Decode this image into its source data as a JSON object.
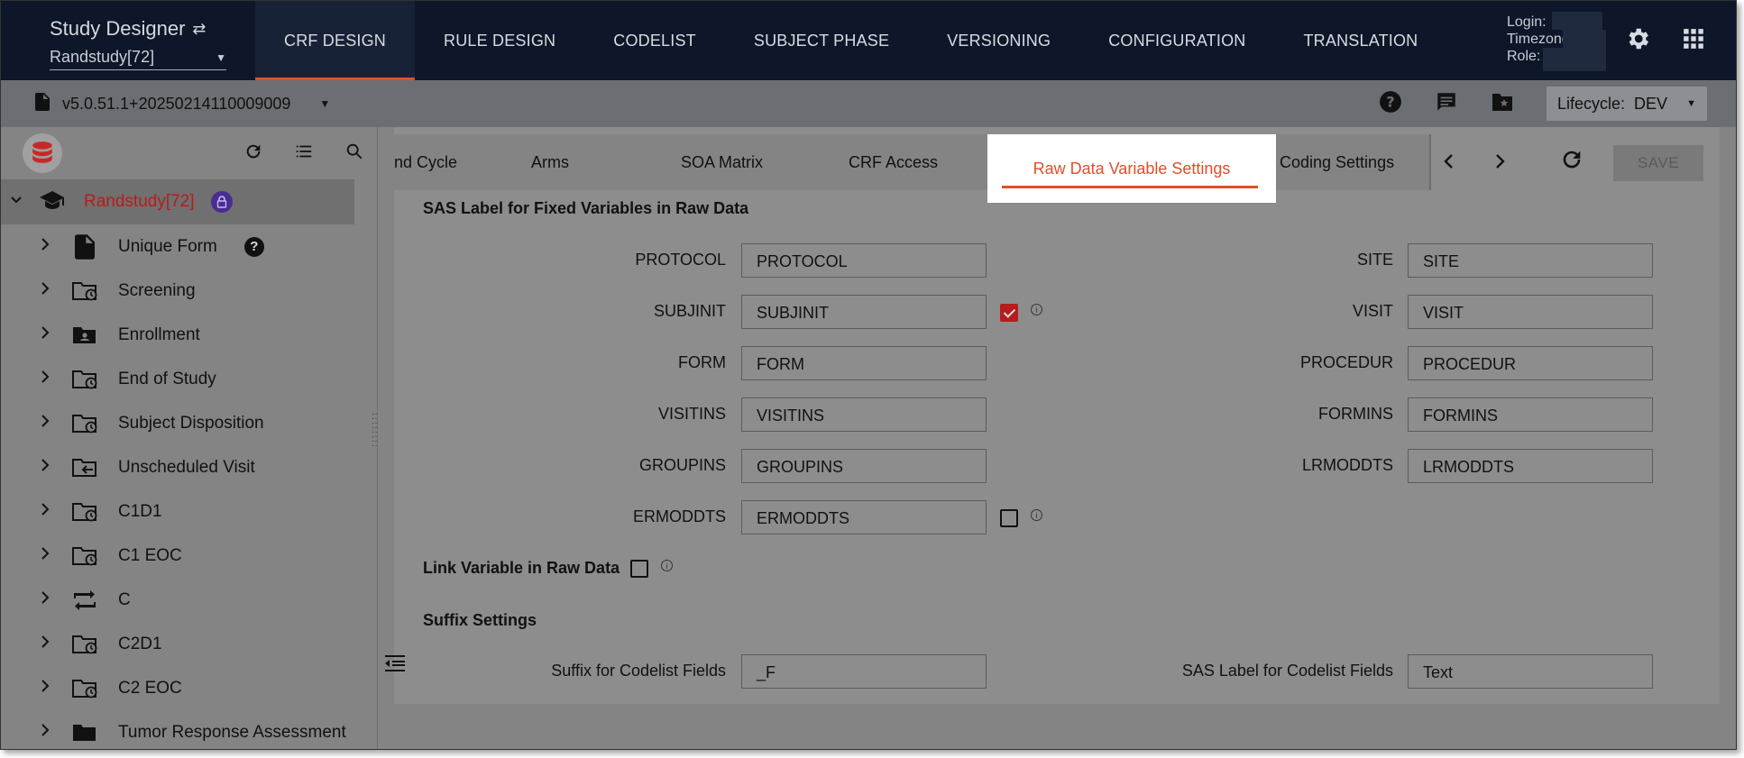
{
  "app": {
    "title": "Study Designer",
    "study_selector": "Randstudy[72]"
  },
  "nav": {
    "tabs": [
      "CRF DESIGN",
      "RULE DESIGN",
      "CODELIST",
      "SUBJECT PHASE",
      "VERSIONING",
      "CONFIGURATION",
      "TRANSLATION"
    ],
    "active": "CRF DESIGN"
  },
  "user": {
    "login_label": "Login:",
    "timezone_label": "Timezone:",
    "role_label": "Role:"
  },
  "subbar": {
    "version": "v5.0.51.1+20250214110009009",
    "lifecycle_label": "Lifecycle:",
    "lifecycle_value": "DEV"
  },
  "tree": {
    "root": "Randstudy[72]",
    "items": [
      {
        "label": "Unique Form",
        "icon": "form-icon"
      },
      {
        "label": "Screening",
        "icon": "folder-clock-icon"
      },
      {
        "label": "Enrollment",
        "icon": "folder-user-icon"
      },
      {
        "label": "End of Study",
        "icon": "folder-clock-icon"
      },
      {
        "label": "Subject Disposition",
        "icon": "folder-clock-icon"
      },
      {
        "label": "Unscheduled Visit",
        "icon": "folder-arrow-icon"
      },
      {
        "label": "C1D1",
        "icon": "folder-clock-icon"
      },
      {
        "label": "C1 EOC",
        "icon": "folder-clock-icon"
      },
      {
        "label": "C",
        "icon": "repeat-icon"
      },
      {
        "label": "C2D1",
        "icon": "folder-clock-icon"
      },
      {
        "label": "C2 EOC",
        "icon": "folder-clock-icon"
      },
      {
        "label": "Tumor Response Assessment",
        "icon": "folder-icon"
      }
    ]
  },
  "content_tabs": {
    "items": [
      "nd Cycle",
      "Arms",
      "SOA Matrix",
      "CRF Access",
      "Raw Data Variable Settings",
      "Coding Settings"
    ],
    "active": "Raw Data Variable Settings",
    "save_label": "SAVE"
  },
  "form": {
    "fixed_vars_title": "SAS Label for Fixed Variables in Raw Data",
    "left_fields": [
      {
        "label": "PROTOCOL",
        "value": "PROTOCOL"
      },
      {
        "label": "SUBJINIT",
        "value": "SUBJINIT"
      },
      {
        "label": "FORM",
        "value": "FORM"
      },
      {
        "label": "VISITINS",
        "value": "VISITINS"
      },
      {
        "label": "GROUPINS",
        "value": "GROUPINS"
      },
      {
        "label": "ERMODDTS",
        "value": "ERMODDTS"
      }
    ],
    "right_fields": [
      {
        "label": "SITE",
        "value": "SITE"
      },
      {
        "label": "VISIT",
        "value": "VISIT"
      },
      {
        "label": "PROCEDUR",
        "value": "PROCEDUR"
      },
      {
        "label": "FORMINS",
        "value": "FORMINS"
      },
      {
        "label": "LRMODDTS",
        "value": "LRMODDTS"
      }
    ],
    "subjinit_checked": true,
    "ermoddts_checked": false,
    "link_variable_label": "Link Variable in Raw Data",
    "link_variable_checked": false,
    "suffix_title": "Suffix Settings",
    "suffix_codelist_label": "Suffix for Codelist Fields",
    "suffix_codelist_value": "_F",
    "sas_label_codelist_label": "SAS Label for Codelist Fields",
    "sas_label_codelist_value": "Text"
  }
}
